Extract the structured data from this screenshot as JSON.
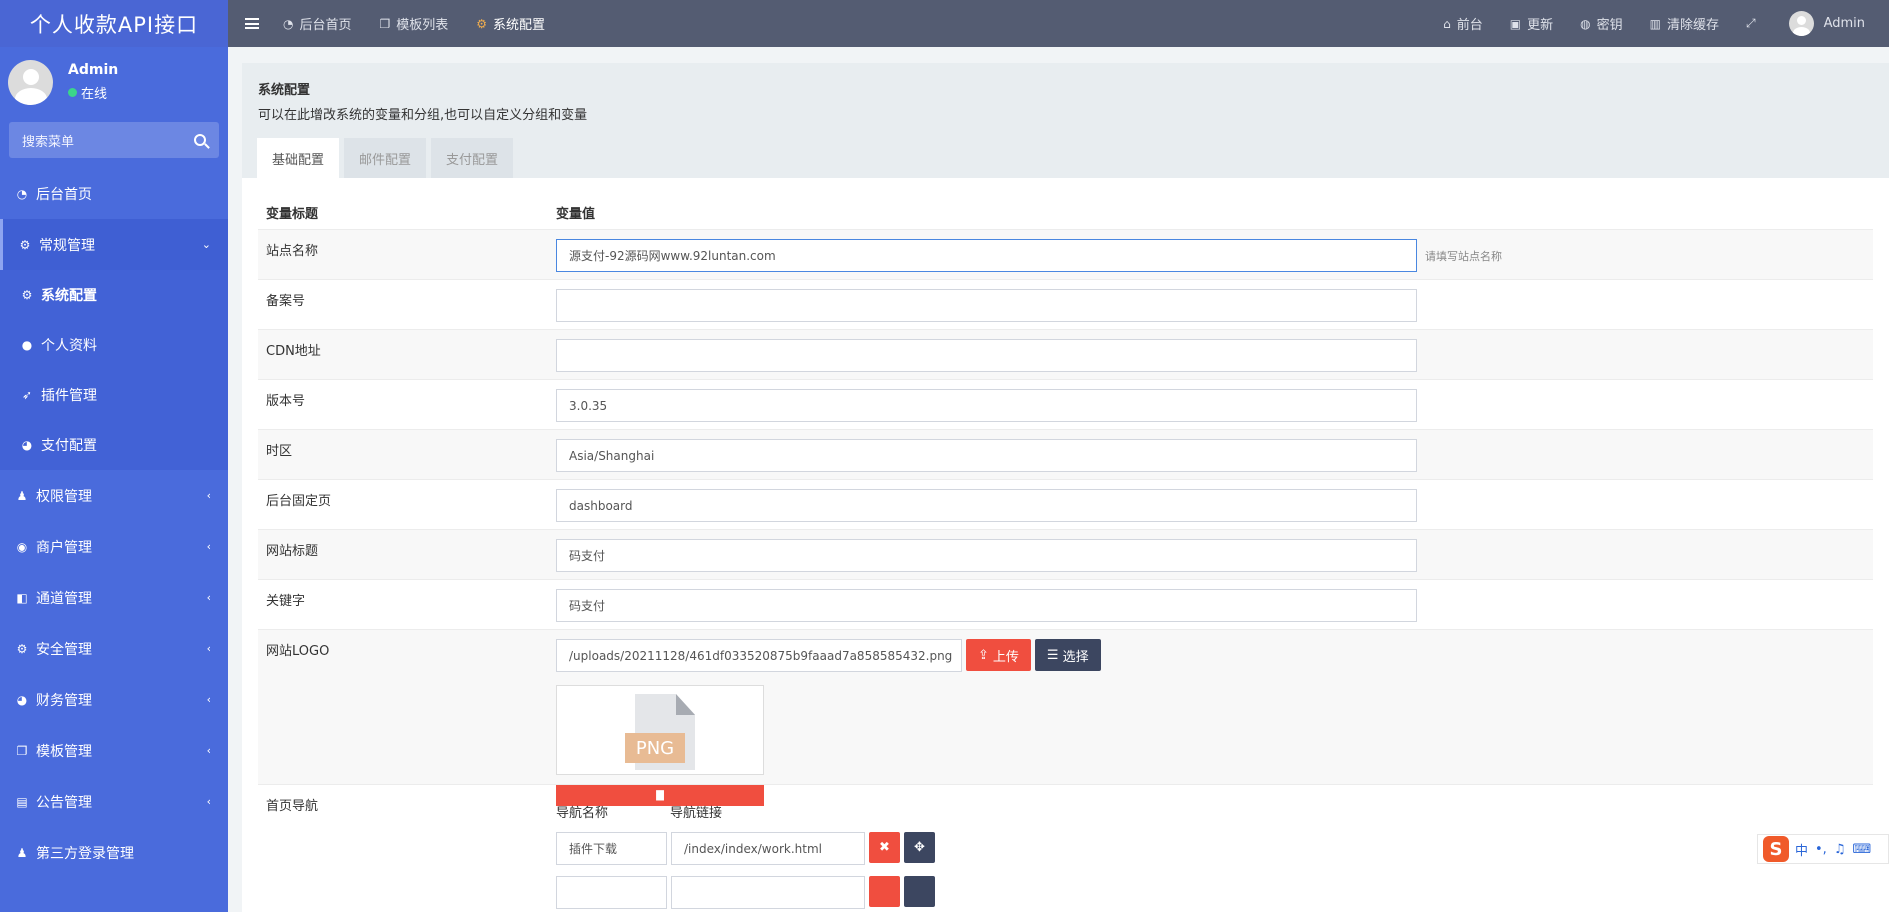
{
  "brand": "个人收款API接口",
  "user": {
    "name": "Admin",
    "status": "在线"
  },
  "search": {
    "placeholder": "搜索菜单"
  },
  "sidebar": {
    "items": [
      {
        "label": "后台首页",
        "icon": "dashboard-icon"
      },
      {
        "label": "常规管理",
        "icon": "cogs-icon",
        "open": true,
        "children": [
          {
            "label": "系统配置",
            "icon": "gear-icon",
            "active": true
          },
          {
            "label": "个人资料",
            "icon": "user-icon"
          },
          {
            "label": "插件管理",
            "icon": "rocket-icon"
          },
          {
            "label": "支付配置",
            "icon": "pie-icon"
          }
        ]
      },
      {
        "label": "权限管理",
        "icon": "group-icon"
      },
      {
        "label": "商户管理",
        "icon": "user-circle-icon"
      },
      {
        "label": "通道管理",
        "icon": "channel-icon"
      },
      {
        "label": "安全管理",
        "icon": "gear-icon"
      },
      {
        "label": "财务管理",
        "icon": "pie-icon"
      },
      {
        "label": "模板管理",
        "icon": "window-icon"
      },
      {
        "label": "公告管理",
        "icon": "file-icon"
      },
      {
        "label": "第三方登录管理",
        "icon": "group-icon"
      }
    ]
  },
  "topbar": {
    "nav": [
      {
        "label": "后台首页",
        "icon": "dashboard-icon"
      },
      {
        "label": "模板列表",
        "icon": "window-icon"
      },
      {
        "label": "系统配置",
        "icon": "gear-icon"
      }
    ],
    "right": [
      {
        "label": "前台",
        "icon": "home-icon"
      },
      {
        "label": "更新",
        "icon": "update-icon"
      },
      {
        "label": "密钥",
        "icon": "key-icon"
      },
      {
        "label": "清除缓存",
        "icon": "trash-icon"
      }
    ],
    "user": "Admin"
  },
  "panel": {
    "title": "系统配置",
    "desc": "可以在此增改系统的变量和分组,也可以自定义分组和变量",
    "tabs": [
      "基础配置",
      "邮件配置",
      "支付配置"
    ]
  },
  "table": {
    "head_label": "变量标题",
    "head_value": "变量值",
    "rows": [
      {
        "label": "站点名称",
        "value": "源支付-92源码网www.92luntan.com",
        "hint": "请填写站点名称"
      },
      {
        "label": "备案号",
        "value": ""
      },
      {
        "label": "CDN地址",
        "value": ""
      },
      {
        "label": "版本号",
        "value": "3.0.35"
      },
      {
        "label": "时区",
        "value": "Asia/Shanghai"
      },
      {
        "label": "后台固定页",
        "value": "dashboard"
      },
      {
        "label": "网站标题",
        "value": "码支付"
      },
      {
        "label": "关键字",
        "value": "码支付"
      }
    ],
    "logo": {
      "label": "网站LOGO",
      "value": "/uploads/20211128/461df033520875b9faaad7a858585432.png",
      "upload": "上传",
      "choose": "选择",
      "preview_text": "PNG"
    },
    "nav": {
      "label": "首页导航",
      "col_name": "导航名称",
      "col_link": "导航链接",
      "rows": [
        {
          "name": "插件下载",
          "link": "/index/index/work.html"
        }
      ]
    }
  },
  "ime": {
    "chars": [
      "中",
      "•,"
    ]
  }
}
